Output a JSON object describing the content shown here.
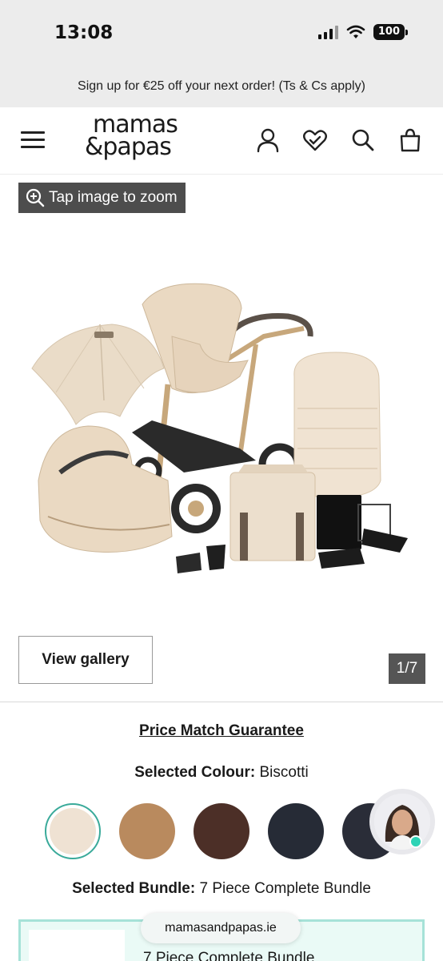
{
  "status_bar": {
    "time": "13:08",
    "battery": "100",
    "icons": [
      "signal-icon",
      "wifi-icon",
      "battery-icon"
    ]
  },
  "promo": {
    "text": "Sign up for €25 off your next order! (Ts & Cs apply)"
  },
  "header": {
    "logo_line1": "mamas",
    "logo_line2": "&papas",
    "icons": [
      "menu-icon",
      "account-icon",
      "wishlist-heart-icon",
      "search-icon",
      "basket-icon"
    ]
  },
  "gallery": {
    "zoom_label": "Tap image to zoom",
    "view_gallery_label": "View gallery",
    "counter": "1/7",
    "product_image": "pram-travel-system-bundle-biscotti"
  },
  "product": {
    "price_match": "Price Match Guarantee",
    "colour_label": "Selected Colour:",
    "colour_value": "Biscotti",
    "swatches": [
      {
        "name": "Biscotti",
        "color": "#efe2d3",
        "selected": true
      },
      {
        "name": "Tan",
        "color": "#b98a5e",
        "selected": false
      },
      {
        "name": "Brown",
        "color": "#4c2f27",
        "selected": false
      },
      {
        "name": "Navy",
        "color": "#262b36",
        "selected": false
      },
      {
        "name": "Dark",
        "color": "#2a2d38",
        "selected": false
      }
    ],
    "bundle_label": "Selected Bundle:",
    "bundle_value": "7 Piece Complete Bundle",
    "bundle_card_title": "7 Piece Complete Bundle"
  },
  "browser": {
    "url": "mamasandpapas.ie"
  },
  "colors": {
    "accent": "#3aaa9a",
    "bundle_card_bg": "#eafaf6",
    "status_bg": "#ececec"
  }
}
